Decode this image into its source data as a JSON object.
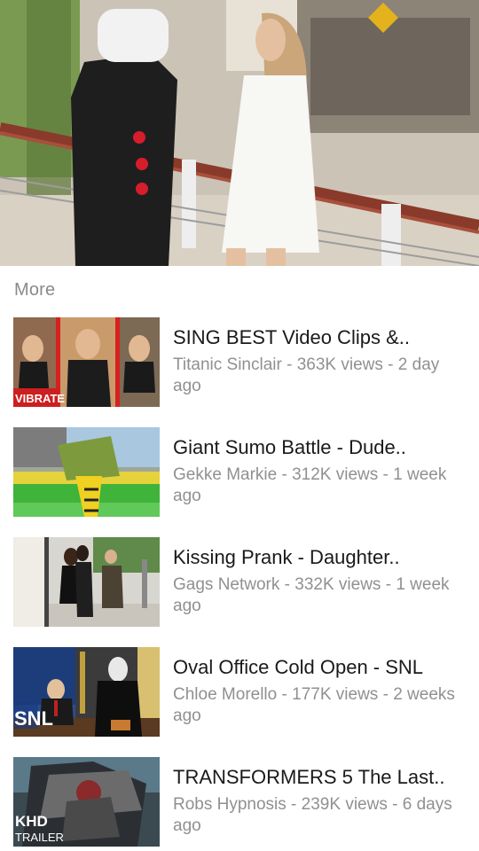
{
  "player": {
    "description_icon": "video-frame"
  },
  "section": {
    "label": "More"
  },
  "videos": [
    {
      "title": "SING  BEST Video Clips &..",
      "channel": "Titanic Sinclair",
      "views": "363K views",
      "age": "2 day ago",
      "badge": "VIBRATE"
    },
    {
      "title": "Giant Sumo Battle - Dude..",
      "channel": "Gekke Markie",
      "views": "312K views",
      "age": "1 week ago"
    },
    {
      "title": "Kissing Prank - Daughter..",
      "channel": "Gags Network",
      "views": "332K views",
      "age": "1 week ago"
    },
    {
      "title": "Oval Office Cold Open - SNL",
      "channel": "Chloe Morello",
      "views": "177K views",
      "age": "2 weeks ago",
      "badge": "SNL"
    },
    {
      "title": "TRANSFORMERS 5 The Last..",
      "channel": "Robs Hypnosis",
      "views": "239K views",
      "age": "6 days ago",
      "badge_top": "KHD",
      "badge_bottom": "TRAILER"
    }
  ],
  "separator": " - "
}
